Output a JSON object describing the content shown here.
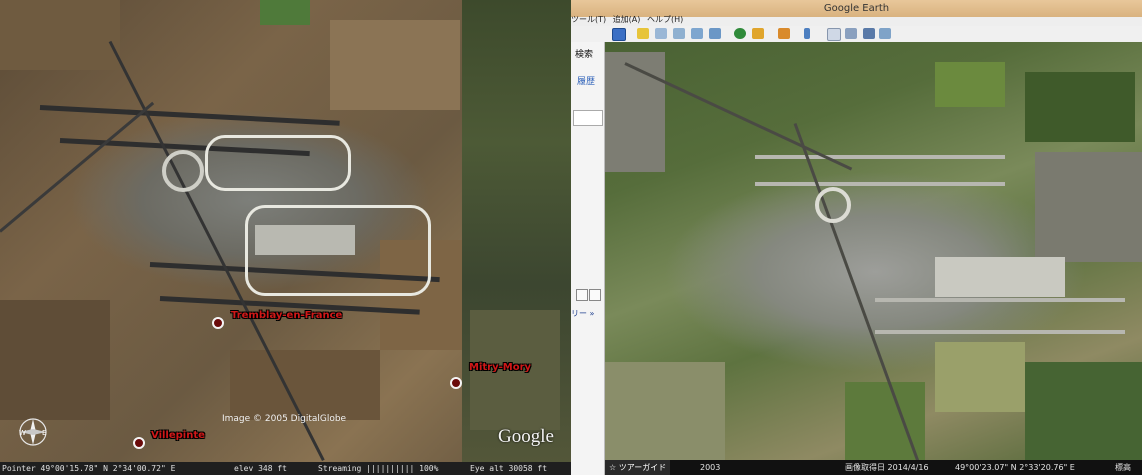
{
  "left": {
    "places": [
      {
        "name": "Tremblay-en-France"
      },
      {
        "name": "Mitry-Mory"
      },
      {
        "name": "Villepinte"
      }
    ],
    "copyright": "Image © 2005 DigitalGlobe",
    "logo": "Google",
    "status": {
      "pointer": "Pointer 49°00'15.78\" N    2°34'00.72\" E",
      "elev": "elev   348 ft",
      "streaming": "Streaming |||||||||| 100%",
      "eye_alt": "Eye  alt    30058 ft"
    }
  },
  "right": {
    "title": "Google Earth",
    "menu": [
      "ツール(T)",
      "追加(A)",
      "ヘルプ(H)"
    ],
    "sidebar": {
      "search_label": "検索",
      "history_label": "履歴",
      "gallery_link": "リー »"
    },
    "status": {
      "tour_guide": "☆ ツアーガイド",
      "year": "2003",
      "imagery_date": "画像取得日  2014/4/16",
      "coords": "49°00'23.07\" N    2°33'20.76\" E",
      "elevation": "標高"
    }
  }
}
